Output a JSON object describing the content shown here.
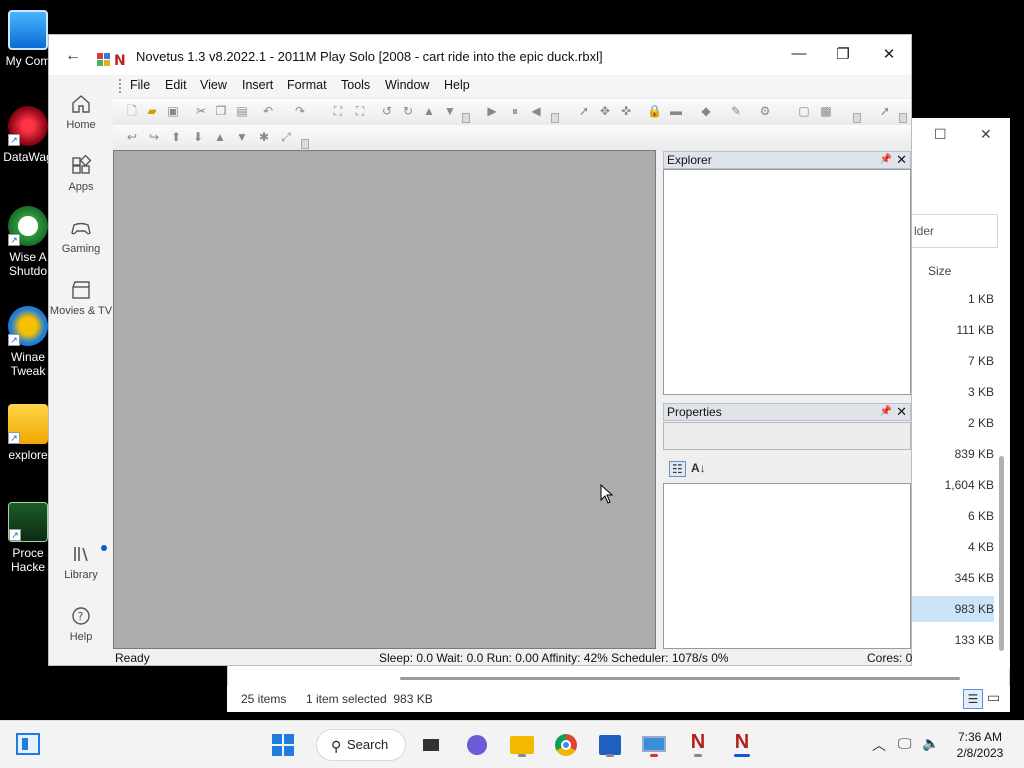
{
  "desktop": {
    "icons": [
      {
        "label": "My Com",
        "icon": "computer-icon"
      },
      {
        "label": "DataWag",
        "icon": "datawag-icon"
      },
      {
        "label": "Wise A",
        "label2": "Shutdo",
        "icon": "wise-shutdown-icon"
      },
      {
        "label": "Winae",
        "label2": "Tweak",
        "icon": "winaero-tweaker-icon"
      },
      {
        "label": "explore",
        "icon": "folder-icon"
      },
      {
        "label": "Proce",
        "label2": "Hacke",
        "icon": "process-hacker-icon"
      }
    ]
  },
  "explorer_bg": {
    "search_placeholder": "lder",
    "size_header": "Size",
    "sizes": [
      "1 KB",
      "111 KB",
      "7 KB",
      "3 KB",
      "2 KB",
      "839 KB",
      "1,604 KB",
      "6 KB",
      "4 KB",
      "345 KB",
      "983 KB",
      "133 KB"
    ],
    "selected_index": 10,
    "status_items": "25 items",
    "status_selected": "1 item selected  983 KB"
  },
  "window": {
    "title": "Novetus 1.3 v8.2022.1 - 2011M Play Solo [2008 - cart ride into the epic duck.rbxl]",
    "minimize": "—",
    "maximize": "❐",
    "close": "✕"
  },
  "sidebar": {
    "items": [
      {
        "label": "Home",
        "icon": "home-icon"
      },
      {
        "label": "Apps",
        "icon": "apps-icon"
      },
      {
        "label": "Gaming",
        "icon": "gamepad-icon"
      },
      {
        "label": "Movies & TV",
        "icon": "clapperboard-icon"
      }
    ],
    "library": "Library",
    "help": "Help"
  },
  "menu": [
    "File",
    "Edit",
    "View",
    "Insert",
    "Format",
    "Tools",
    "Window",
    "Help"
  ],
  "explorer_panel": {
    "title": "Explorer"
  },
  "properties_panel": {
    "title": "Properties"
  },
  "status": {
    "ready": "Ready",
    "stats": "Sleep: 0.0 Wait: 0.0 Run: 0.00 Affinity: 42% Scheduler: 1078/s 0%",
    "cores": "Cores: 0"
  },
  "taskbar": {
    "search": "Search",
    "time": "7:36 AM",
    "date": "2/8/2023"
  },
  "colors": {
    "accent": "#0a5bd5",
    "viewport": "#acacac"
  }
}
